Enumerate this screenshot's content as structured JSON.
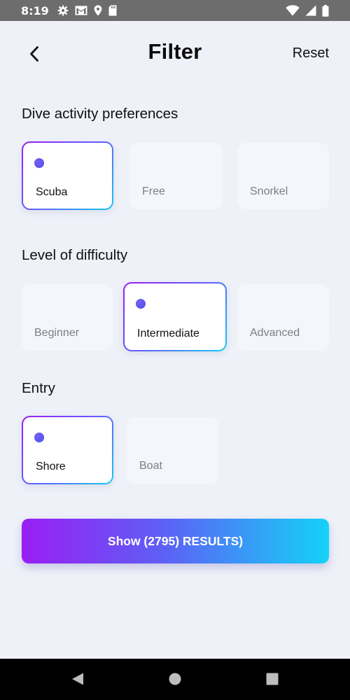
{
  "status_bar": {
    "time": "8:19",
    "left_icons": [
      "gear-icon",
      "gmail-icon",
      "location-icon",
      "sd-card-icon"
    ],
    "right_icons": [
      "wifi-icon",
      "signal-icon",
      "battery-icon"
    ]
  },
  "header": {
    "title": "Filter",
    "reset_label": "Reset"
  },
  "sections": [
    {
      "label": "Dive activity preferences",
      "options": [
        {
          "label": "Scuba",
          "selected": true
        },
        {
          "label": "Free",
          "selected": false
        },
        {
          "label": "Snorkel",
          "selected": false
        }
      ]
    },
    {
      "label": "Level of difficulty",
      "options": [
        {
          "label": "Beginner",
          "selected": false
        },
        {
          "label": "Intermediate",
          "selected": true
        },
        {
          "label": "Advanced",
          "selected": false
        }
      ]
    },
    {
      "label": "Entry",
      "options": [
        {
          "label": "Shore",
          "selected": true
        },
        {
          "label": "Boat",
          "selected": false
        }
      ]
    }
  ],
  "cta": {
    "label": "Show (2795) RESULTS)"
  },
  "colors": {
    "gradient_start": "#9a1ef3",
    "gradient_mid": "#5f5ef5",
    "gradient_end": "#14d2f7",
    "background": "#eef1f8",
    "card_unselected": "#f4f6fb"
  },
  "nav_bar": {
    "buttons": [
      "back-triangle-icon",
      "home-circle-icon",
      "recents-square-icon"
    ]
  }
}
